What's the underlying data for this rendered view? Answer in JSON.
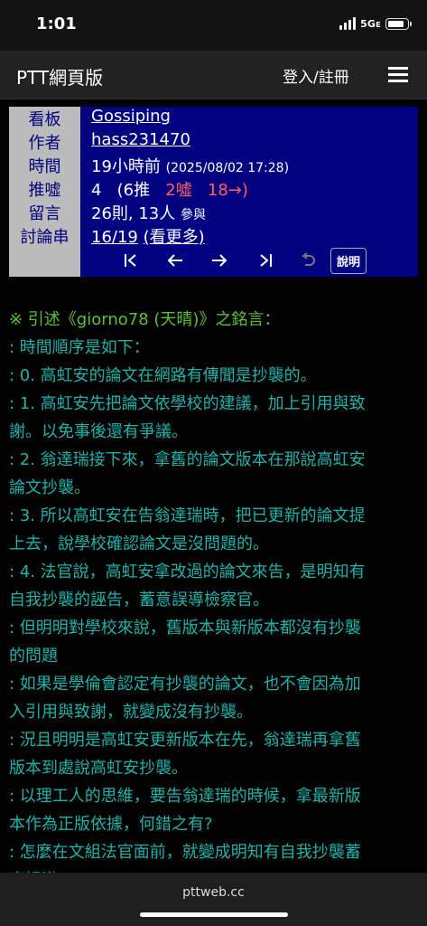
{
  "status": {
    "time": "1:01",
    "network": "5Gᴇ"
  },
  "header": {
    "site_title": "PTT網頁版",
    "login": "登入/註冊"
  },
  "meta": {
    "labels": {
      "board": "看板",
      "author": "作者",
      "time": "時間",
      "push": "推噓",
      "comments": "留言",
      "thread": "討論串"
    },
    "board": "Gossiping",
    "author": "hass231470",
    "time_relative": "19小時前",
    "time_absolute": "(2025/08/02 17:28)",
    "push_score": "4",
    "push_open": "(6推",
    "push_boo": "2噓",
    "push_arrow": "18→)",
    "comments_count": "26則, 13人",
    "comments_suffix": "參與",
    "thread_pos": "16/19",
    "thread_more": "(看更多)",
    "help_label": "說明"
  },
  "content": {
    "lines": [
      "※ 引述《giorno78 (天晴)》之銘言：",
      ": 時間順序是如下：",
      ": 0. 高虹安的論文在網路有傳聞是抄襲的。",
      ": 1. 高虹安先把論文依學校的建議，加上引用與致",
      "謝。以免事後還有爭議。",
      ": 2. 翁達瑞接下來，拿舊的論文版本在那說高虹安",
      "論文抄襲。",
      ": 3. 所以高虹安在告翁達瑞時，把已更新的論文提",
      "上去，說學校確認論文是沒問題的。",
      ": 4. 法官說，高虹安拿改過的論文來告，是明知有",
      "自我抄襲的誣告，蓄意誤導檢察官。",
      ": 但明明對學校來說，舊版本與新版本都沒有抄襲",
      "的問題",
      ": 如果是學倫會認定有抄襲的論文，也不會因為加",
      "入引用與致謝，就變成沒有抄襲。",
      ": 況且明明是高虹安更新版本在先，翁達瑞再拿舊",
      "版本到處說高虹安抄襲。",
      ": 以理工人的思維，要告翁達瑞的時候，拿最新版",
      "本作為正版依據，何錯之有?",
      ": 怎麼在文組法官面前，就變成明知有自我抄襲蓄",
      "意誤導?"
    ]
  },
  "browser": {
    "url": "pttweb.cc"
  }
}
